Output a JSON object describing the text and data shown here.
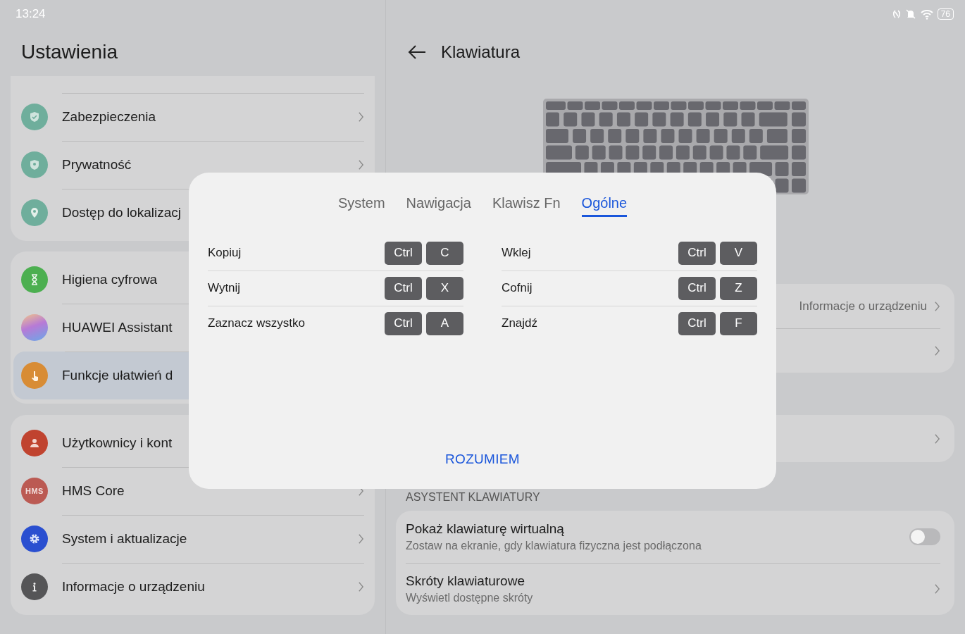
{
  "status_bar": {
    "time": "13:24",
    "battery": "76"
  },
  "settings": {
    "title": "Ustawienia",
    "groups": [
      [
        {
          "label": "Zabezpieczenia",
          "kind": "security"
        },
        {
          "label": "Prywatność",
          "kind": "privacy"
        },
        {
          "label": "Dostęp do lokalizacj",
          "kind": "location"
        }
      ],
      [
        {
          "label": "Higiena cyfrowa",
          "kind": "wellbeing",
          "selected": false
        },
        {
          "label": "HUAWEI Assistant",
          "kind": "assistant",
          "selected": false
        },
        {
          "label": "Funkcje ułatwień d",
          "kind": "accessibility",
          "selected": true
        }
      ],
      [
        {
          "label": "Użytkownicy i kont",
          "kind": "users"
        },
        {
          "label": "HMS Core",
          "kind": "hms",
          "icon_text": "HMS"
        },
        {
          "label": "System i aktualizacje",
          "kind": "system"
        },
        {
          "label": "Informacje o urządzeniu",
          "kind": "info"
        }
      ]
    ]
  },
  "keyboard_page": {
    "title": "Klawiatura",
    "device_info_value": "Informacje o urządzeniu",
    "section": "ASYSTENT KLAWIATURY",
    "assistant": [
      {
        "kind": "toggle",
        "title": "Pokaż klawiaturę wirtualną",
        "subtitle": "Zostaw na ekranie, gdy klawiatura fizyczna jest podłączona",
        "on": false
      },
      {
        "kind": "link",
        "title": "Skróty klawiaturowe",
        "subtitle": "Wyświetl dostępne skróty"
      }
    ]
  },
  "dialog": {
    "tabs": [
      {
        "label": "System",
        "selected": false
      },
      {
        "label": "Nawigacja",
        "selected": false
      },
      {
        "label": "Klawisz Fn",
        "selected": false
      },
      {
        "label": "Ogólne",
        "selected": true
      }
    ],
    "columns": [
      [
        {
          "label": "Kopiuj",
          "keys": [
            "Ctrl",
            "C"
          ]
        },
        {
          "label": "Wytnij",
          "keys": [
            "Ctrl",
            "X"
          ]
        },
        {
          "label": "Zaznacz wszystko",
          "keys": [
            "Ctrl",
            "A"
          ]
        }
      ],
      [
        {
          "label": "Wklej",
          "keys": [
            "Ctrl",
            "V"
          ]
        },
        {
          "label": "Cofnij",
          "keys": [
            "Ctrl",
            "Z"
          ]
        },
        {
          "label": "Znajdź",
          "keys": [
            "Ctrl",
            "F"
          ]
        }
      ]
    ],
    "button": "ROZUMIEM"
  }
}
